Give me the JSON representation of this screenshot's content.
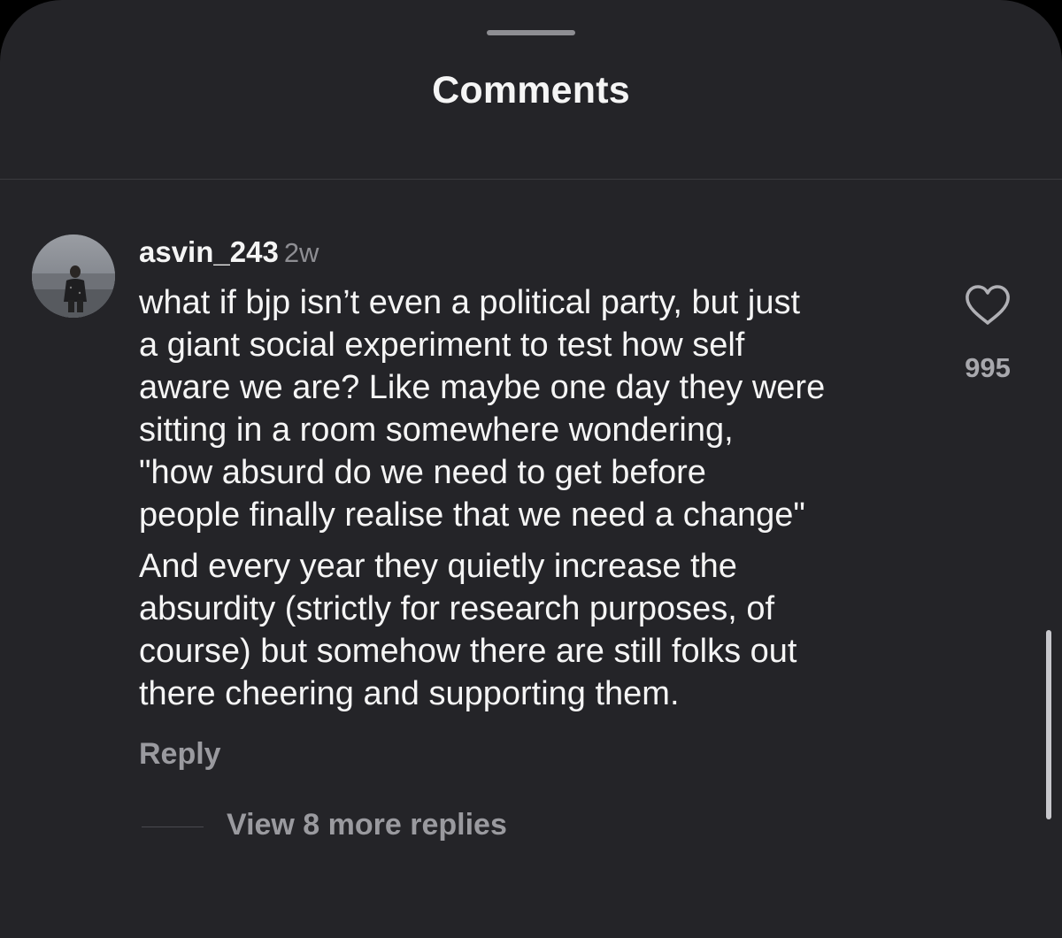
{
  "header": {
    "title": "Comments"
  },
  "comment": {
    "username": "asvin_243",
    "time_ago": "2w",
    "paragraphs": [
      "what if bjp isn’t even a political party, but just\na giant social experiment to test how self\naware we are? Like maybe one day they were\nsitting in a room somewhere wondering,\n\"how absurd do we need to get before\npeople finally realise that we need a change\"",
      "And every year they quietly increase the\nabsurdity (strictly for research purposes, of\ncourse) but somehow there are still folks out\nthere cheering and supporting them."
    ],
    "like_count": "995",
    "reply_label": "Reply",
    "view_replies_label": "View 8 more replies"
  },
  "icons": {
    "like": "heart-outline-icon",
    "avatar": "profile-photo"
  },
  "colors": {
    "sheet_background": "#242428",
    "primary_text": "#f5f5f5",
    "secondary_text": "#8e8e93"
  }
}
